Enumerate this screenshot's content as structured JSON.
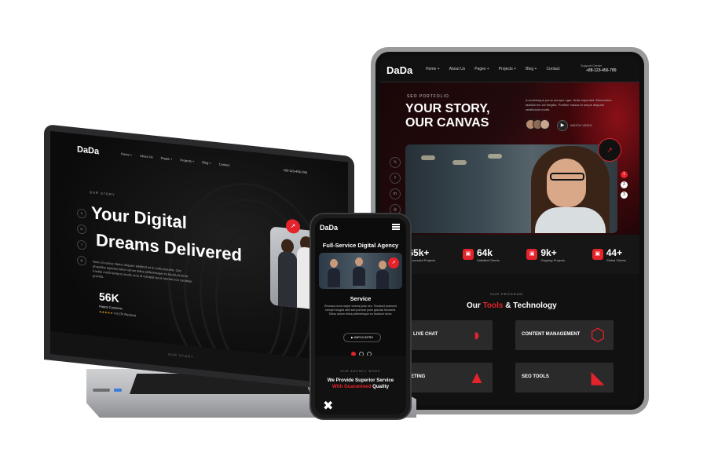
{
  "tablet": {
    "logo": "DaDa",
    "nav": [
      "Home +",
      "About Us",
      "Pages +",
      "Projects +",
      "Blog +",
      "Contact"
    ],
    "support_label": "Support Center",
    "phone": "+88-123-456-789",
    "kicker": "SEO PORTFOLIO",
    "headline_1": "YOUR STORY,",
    "headline_2": "OUR CANVAS",
    "paragraph": "A scelerisque purus semper eget. Nulla imperdiet. Elementum facilisis leo vel fringilla. Porttitor massa id neque aliquam vestibulum morbi.",
    "watch_label": "WATCH VIDEO",
    "play_icon": "▶",
    "social": [
      "𝕏",
      "f",
      "in",
      "◎"
    ],
    "pager": [
      "1",
      "2",
      "3"
    ],
    "stats": [
      {
        "value": "65k+",
        "label": "Successful Projects",
        "icon": "▣"
      },
      {
        "value": "64k",
        "label": "Satisfied Clients",
        "icon": "▣"
      },
      {
        "value": "9k+",
        "label": "Ongoing Projects",
        "icon": "▣"
      },
      {
        "value": "44+",
        "label": "Global Clients",
        "icon": "▣"
      }
    ],
    "services_kicker": "OUR PROGRAM",
    "services_title_1": "Our ",
    "services_title_red": "Tools",
    "services_title_2": " & Technology",
    "services": [
      {
        "label": "OT & LIVE CHAT",
        "icon": "◗"
      },
      {
        "label": "CONTENT MANAGEMENT",
        "icon": "⬡"
      },
      {
        "label": "ARKETING",
        "icon": "▲"
      },
      {
        "label": "SEO TOOLS",
        "icon": "◣"
      }
    ]
  },
  "laptop": {
    "logo": "DaDa",
    "nav": [
      "Home +",
      "About Us",
      "Pages +",
      "Projects +",
      "Blog +",
      "Contact"
    ],
    "phone": "+88-123-456-789",
    "kicker": "OUR STORY",
    "headline_1": "Your Digital",
    "headline_2": "Dreams Delivered",
    "paragraph": "Nunc id cursus metus aliquam eleifend mi in nulla posuere. Orci phasellus egestas tellus rutrum tellus pellentesque eu tincidunt tortor. Facilisi morbi tempus iaculis urna id volutpat lacus laoreet non curabitur gravida.",
    "stat_value": "56K",
    "stat_label": "Happy Customer",
    "rating": "★★★★★",
    "rating_text": " 4.9 (7k Review)",
    "social": [
      "𝕏",
      "in",
      "f",
      "◎"
    ],
    "footer_kicker": "OUR STORY"
  },
  "phone": {
    "logo": "DaDa",
    "title": "Full-Service Digital Agency",
    "service": "Service",
    "paragraph": "Rhoncus urna neque viverra justo nec. Tincidunt praesent semper feugiat nibh sed pulvinar proin gravida hendrerit. Tellus rutrum tellus pellentesque eu tincidunt tortor.",
    "watch_label": "WATCH INTRO",
    "kicker": "OUR AGENCY WORK",
    "line_1": "We Provide Superior Service",
    "line_2_red": "With Guaranteed",
    "line_2_white": " Quality",
    "bottom_icon": "✖"
  },
  "colors": {
    "accent": "#e4232b",
    "background": "#0e0e0e"
  }
}
